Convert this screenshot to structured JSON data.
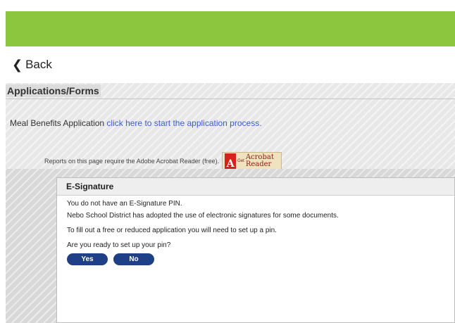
{
  "nav": {
    "back_label": "Back"
  },
  "section": {
    "title": "Applications/Forms",
    "meal_prefix": "Meal Benefits Application ",
    "meal_link": "click here to start the application process.",
    "reports_text": "Reports on this page require the Adobe Acrobat Reader (free).",
    "adobe_badge": {
      "get": "Get",
      "line1": "Acrobat",
      "line2": "Reader"
    }
  },
  "dialog": {
    "title": "E-Signature",
    "lines": [
      "You do not have an E-Signature PIN.",
      "Nebo School District has adopted the use of electronic signatures for some documents.",
      "To fill out a free or reduced application you will need to set up a pin.",
      "Are you ready to set up your pin?"
    ],
    "yes_label": "Yes",
    "no_label": "No"
  },
  "colors": {
    "header_green": "#8cc63f",
    "link_blue": "#3b5bd5",
    "button_navy": "#1f3f86"
  }
}
